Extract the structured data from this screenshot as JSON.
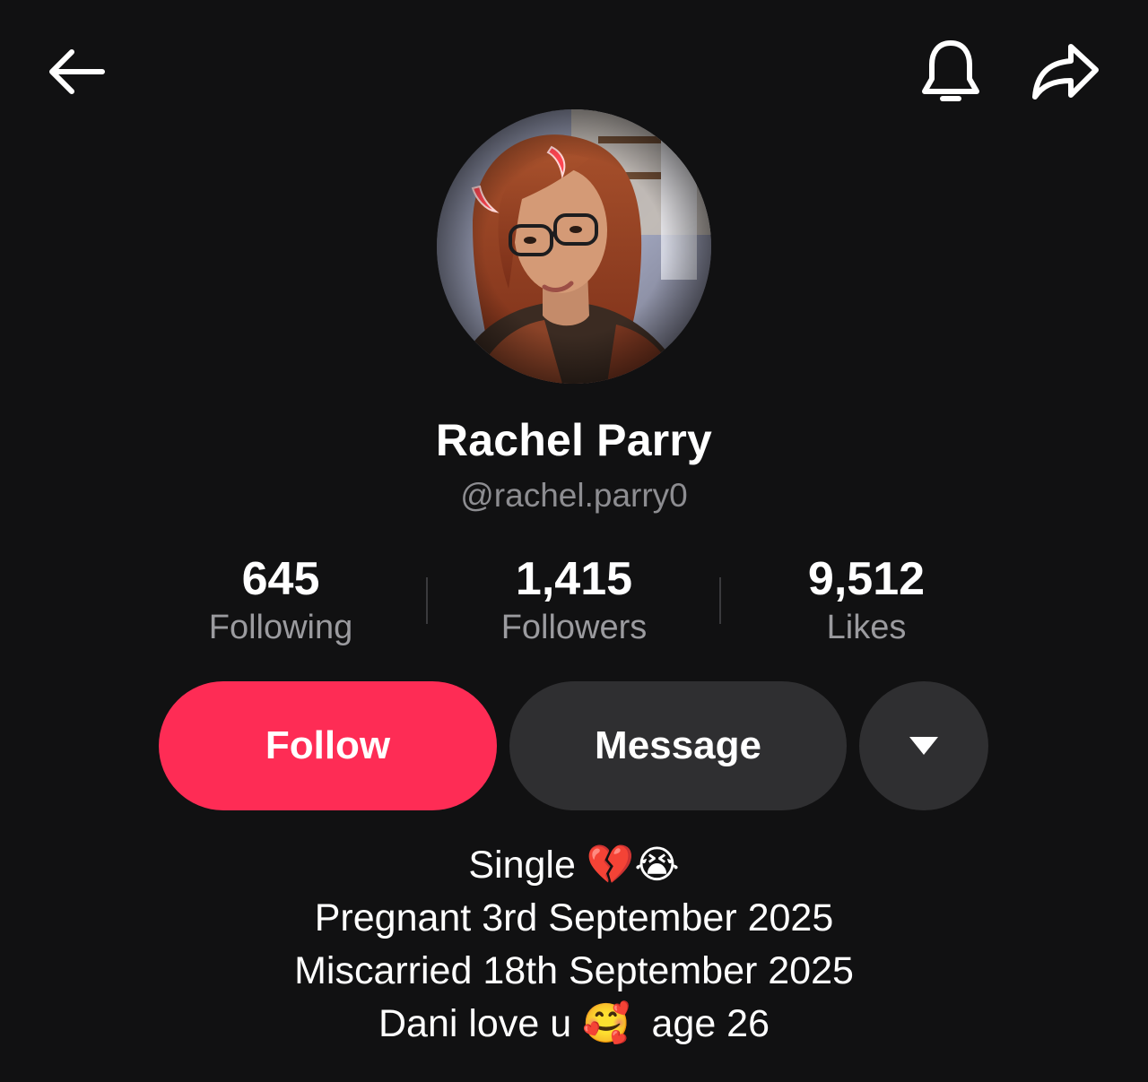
{
  "header": {
    "back_icon": "arrow-left-icon",
    "notification_icon": "bell-icon",
    "share_icon": "share-arrow-icon"
  },
  "profile": {
    "display_name": "Rachel Parry",
    "username": "@rachel.parry0",
    "avatar_icon": "profile-photo"
  },
  "stats": [
    {
      "value": "645",
      "label": "Following"
    },
    {
      "value": "1,415",
      "label": "Followers"
    },
    {
      "value": "9,512",
      "label": "Likes"
    }
  ],
  "actions": {
    "follow_label": "Follow",
    "message_label": "Message",
    "more_icon": "caret-down-icon"
  },
  "bio": [
    "Single 💔😭",
    "Pregnant 3rd September 2025",
    "Miscarried 18th September 2025",
    "Dani love u 🥰  age 26"
  ],
  "colors": {
    "background": "#111112",
    "follow_button": "#fe2c55",
    "secondary_button": "#2f2f31",
    "muted_text": "#8d8d91"
  }
}
